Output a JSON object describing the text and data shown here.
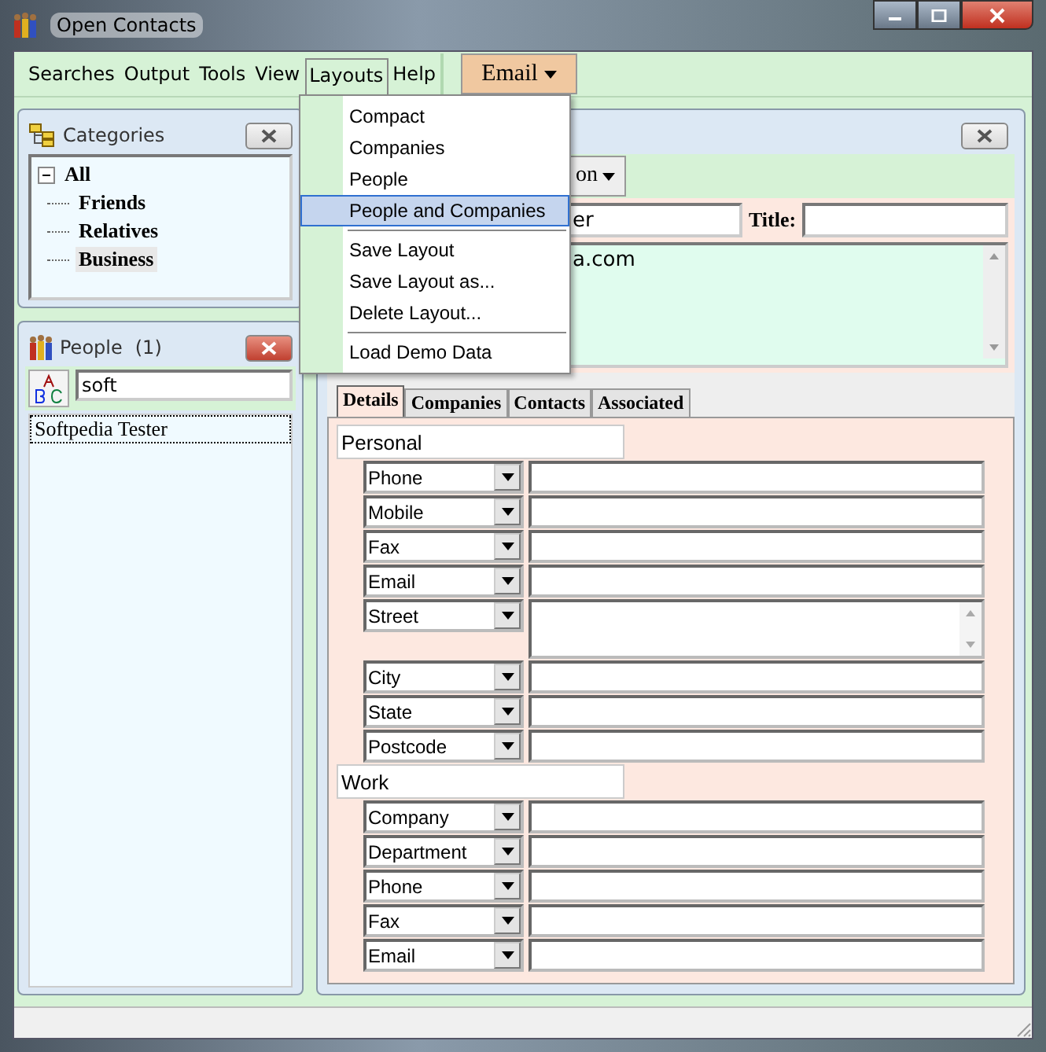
{
  "window": {
    "title": "Open Contacts"
  },
  "menu_bar": [
    {
      "label": "Searches",
      "selected": false
    },
    {
      "label": "Output",
      "selected": false
    },
    {
      "label": "Tools",
      "selected": false
    },
    {
      "label": "View",
      "selected": false
    },
    {
      "label": "Layouts",
      "selected": true
    },
    {
      "label": "Help",
      "selected": false
    }
  ],
  "email_button": {
    "label": "Email"
  },
  "layouts_menu": [
    {
      "kind": "item",
      "label": "Compact",
      "selected": false
    },
    {
      "kind": "item",
      "label": "Companies",
      "selected": false
    },
    {
      "kind": "item",
      "label": "People",
      "selected": false
    },
    {
      "kind": "item",
      "label": "People and Companies",
      "selected": true
    },
    {
      "kind": "separator"
    },
    {
      "kind": "item",
      "label": "Save Layout",
      "selected": false
    },
    {
      "kind": "item",
      "label": "Save Layout as...",
      "selected": false
    },
    {
      "kind": "item",
      "label": "Delete Layout...",
      "selected": false
    },
    {
      "kind": "separator"
    },
    {
      "kind": "item",
      "label": "Load Demo Data",
      "selected": false
    }
  ],
  "categories": {
    "title": "Categories",
    "tree": [
      {
        "label": "All",
        "expanded": true,
        "selected": false,
        "children": [
          {
            "label": "Friends",
            "selected": false
          },
          {
            "label": "Relatives",
            "selected": false
          },
          {
            "label": "Business",
            "selected": true
          }
        ]
      }
    ]
  },
  "people": {
    "title": "People",
    "count": "(1)",
    "search_value": "soft",
    "rows": [
      {
        "name": "Softpedia Tester",
        "selected": true
      }
    ]
  },
  "contact": {
    "view_button": "on",
    "name_value": "er",
    "title_label": "Title:",
    "notes_value": "a.com",
    "tabs": [
      {
        "label": "Details",
        "selected": true
      },
      {
        "label": "Companies",
        "selected": false
      },
      {
        "label": "Contacts",
        "selected": false
      },
      {
        "label": "Associated",
        "selected": false
      }
    ],
    "sections": [
      {
        "title": "Personal",
        "fields": [
          {
            "label": "Phone",
            "kind": "line"
          },
          {
            "label": "Mobile",
            "kind": "line"
          },
          {
            "label": "Fax",
            "kind": "line"
          },
          {
            "label": "Email",
            "kind": "line"
          },
          {
            "label": "Street",
            "kind": "multiline"
          },
          {
            "label": "City",
            "kind": "line"
          },
          {
            "label": "State",
            "kind": "line"
          },
          {
            "label": "Postcode",
            "kind": "line"
          }
        ]
      },
      {
        "title": "Work",
        "fields": [
          {
            "label": "Company",
            "kind": "line"
          },
          {
            "label": "Department",
            "kind": "line"
          },
          {
            "label": "Phone",
            "kind": "line"
          },
          {
            "label": "Fax",
            "kind": "line"
          },
          {
            "label": "Email",
            "kind": "line"
          }
        ]
      }
    ]
  }
}
